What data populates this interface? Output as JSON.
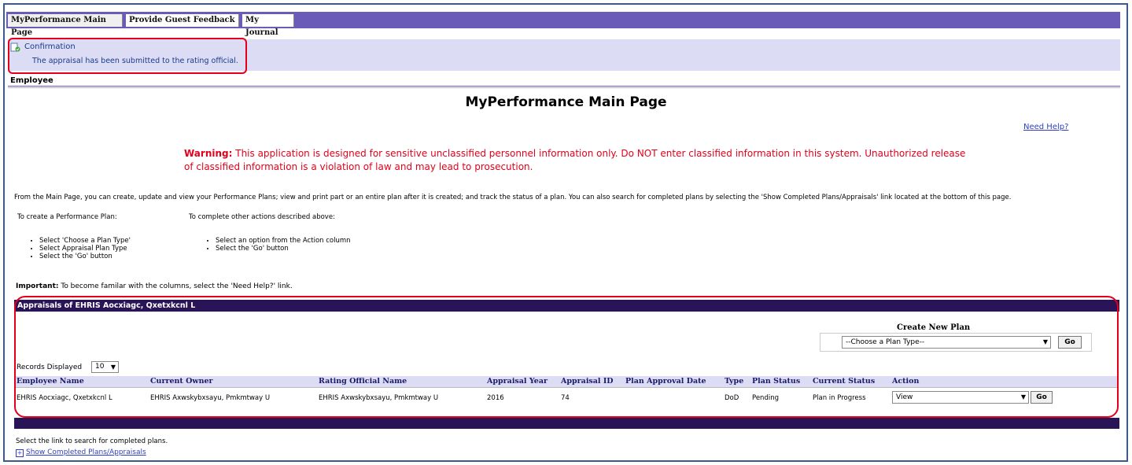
{
  "tabs": [
    {
      "label": "MyPerformance Main Page"
    },
    {
      "label": "Provide Guest Feedback"
    },
    {
      "label": "My Journal"
    }
  ],
  "confirmation": {
    "title": "Confirmation",
    "message": "The appraisal has been submitted to the rating official."
  },
  "employee_label": "Employee",
  "page_title": "MyPerformance Main Page",
  "need_help": "Need Help?",
  "warning": {
    "lead": "Warning:",
    "text": " This application is designed for sensitive unclassified personnel information only. Do NOT enter classified information in this system. Unauthorized release of classified information is a violation of law and may lead to prosecution."
  },
  "intro": "From the Main Page, you can create, update and view your Performance Plans; view and print part or an entire plan after it is created; and track the status of a plan. You can also search for completed plans by selecting the 'Show Completed Plans/Appraisals' link located at the bottom of this page.",
  "create_plan": {
    "label": "To create a Performance Plan:",
    "steps": [
      "Select 'Choose a Plan Type'",
      "Select Appraisal Plan Type",
      "Select the 'Go' button"
    ]
  },
  "other_actions": {
    "label": "To complete other actions described above:",
    "steps": [
      "Select an option from the Action column",
      "Select the 'Go' button"
    ]
  },
  "important": {
    "lead": "Important:",
    "text": " To become familar with the columns, select the 'Need Help?' link."
  },
  "appraisals": {
    "header": "Appraisals of EHRIS Aocxiagc, Qxetxkcnl L",
    "create_new_plan": {
      "label": "Create New Plan",
      "select_value": "--Choose a Plan Type--",
      "go_label": "Go"
    },
    "records_label": "Records Displayed",
    "records_value": "10",
    "columns": [
      "Employee Name",
      "Current Owner",
      "Rating Official Name",
      "Appraisal Year",
      "Appraisal ID",
      "Plan Approval Date",
      "Type",
      "Plan Status",
      "Current Status",
      "Action"
    ],
    "rows": [
      {
        "employee_name": "EHRIS Aocxiagc, Qxetxkcnl L",
        "current_owner": "EHRIS Axwskybxsayu, Pmkmtway U",
        "rating_official": "EHRIS Axwskybxsayu, Pmkmtway U",
        "appraisal_year": "2016",
        "appraisal_id": "74",
        "plan_approval_date": "",
        "type": "DoD",
        "plan_status": "Pending",
        "current_status": "Plan in Progress",
        "action": "View",
        "go_label": "Go"
      }
    ]
  },
  "footer": {
    "select_link_text": "Select the link to search for completed plans.",
    "show_completed": "Show Completed Plans/Appraisals"
  },
  "colors": {
    "tab_bar": "#6b5bb8",
    "section_bar": "#2a1458",
    "highlight": "#e3001b",
    "warning_text": "#e3001b",
    "link": "#2d3fc0",
    "confirmation_bg": "#dcdcf4"
  }
}
